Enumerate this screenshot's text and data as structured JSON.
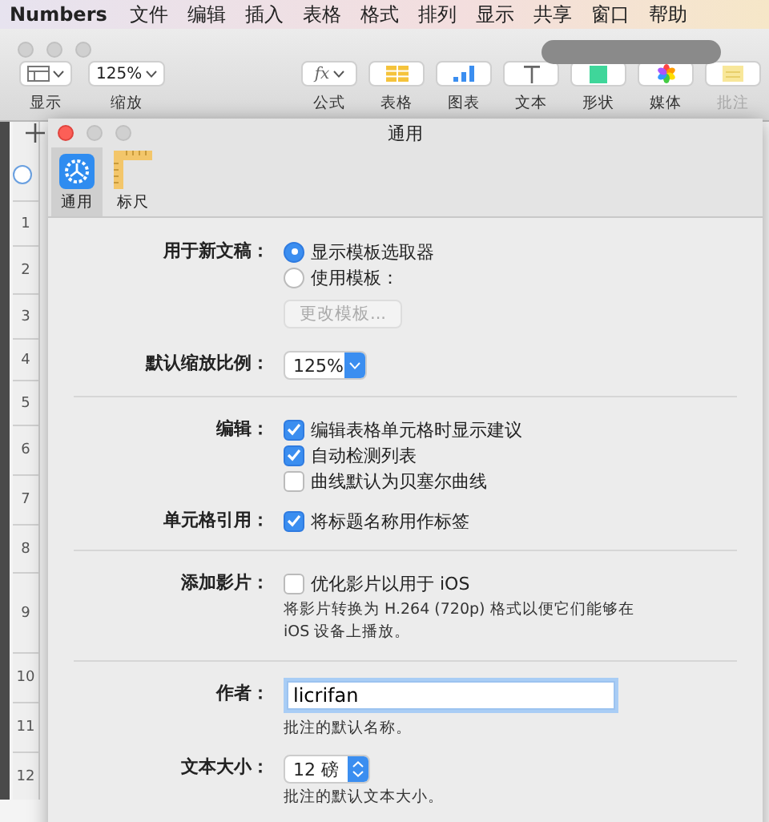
{
  "menu_bar": {
    "app": "Numbers",
    "items": [
      "文件",
      "编辑",
      "插入",
      "表格",
      "格式",
      "排列",
      "显示",
      "共享",
      "窗口",
      "帮助"
    ]
  },
  "toolbar": {
    "left": [
      {
        "label": "显示",
        "kind": "view"
      },
      {
        "label": "缩放",
        "kind": "zoom",
        "value": "125%"
      }
    ],
    "right": [
      {
        "label": "公式",
        "kind": "formula",
        "glyph": "fx",
        "disabled": false
      },
      {
        "label": "表格",
        "kind": "table",
        "disabled": false
      },
      {
        "label": "图表",
        "kind": "chart",
        "disabled": false
      },
      {
        "label": "文本",
        "kind": "text",
        "disabled": false
      },
      {
        "label": "形状",
        "kind": "shape",
        "disabled": false
      },
      {
        "label": "媒体",
        "kind": "media",
        "disabled": false
      },
      {
        "label": "批注",
        "kind": "comment",
        "disabled": true
      }
    ]
  },
  "sheet": {
    "rows": [
      "1",
      "2",
      "3",
      "4",
      "5",
      "6",
      "7",
      "8",
      "9",
      "10",
      "11",
      "12"
    ]
  },
  "dialog": {
    "title": "通用",
    "tabs": [
      {
        "label": "通用",
        "kind": "general",
        "selected": true
      },
      {
        "label": "标尺",
        "kind": "ruler",
        "selected": false
      }
    ],
    "groups": [
      [
        {
          "label": "用于新文稿：",
          "controls": [
            {
              "kind": "radio",
              "text": "显示模板选取器",
              "selected": true
            },
            {
              "kind": "radio",
              "text": "使用模板：",
              "selected": false
            },
            {
              "kind": "button",
              "text": "更改模板...",
              "disabled": true
            }
          ]
        },
        {
          "label": "默认缩放比例：",
          "controls": [
            {
              "kind": "popup",
              "value": "125%"
            }
          ]
        }
      ],
      [
        {
          "label": "编辑：",
          "controls": [
            {
              "kind": "checkbox",
              "text": "编辑表格单元格时显示建议",
              "checked": true
            },
            {
              "kind": "checkbox",
              "text": "自动检测列表",
              "checked": true
            },
            {
              "kind": "checkbox",
              "text": "曲线默认为贝塞尔曲线",
              "checked": false
            }
          ]
        },
        {
          "label": "单元格引用：",
          "controls": [
            {
              "kind": "checkbox",
              "text": "将标题名称用作标签",
              "checked": true
            }
          ]
        }
      ],
      [
        {
          "label": "添加影片：",
          "controls": [
            {
              "kind": "checkbox",
              "text": "优化影片以用于 iOS",
              "checked": false
            },
            {
              "kind": "note",
              "text": "将影片转换为 H.264 (720p) 格式以便它们能够在 iOS 设备上播放。"
            }
          ]
        }
      ],
      [
        {
          "label": "作者：",
          "controls": [
            {
              "kind": "field",
              "value": "licrifan"
            },
            {
              "kind": "note",
              "text": "批注的默认名称。"
            }
          ]
        },
        {
          "label": "文本大小：",
          "controls": [
            {
              "kind": "stepper",
              "value": "12 磅"
            },
            {
              "kind": "note",
              "text": "批注的默认文本大小。"
            }
          ]
        }
      ]
    ]
  }
}
